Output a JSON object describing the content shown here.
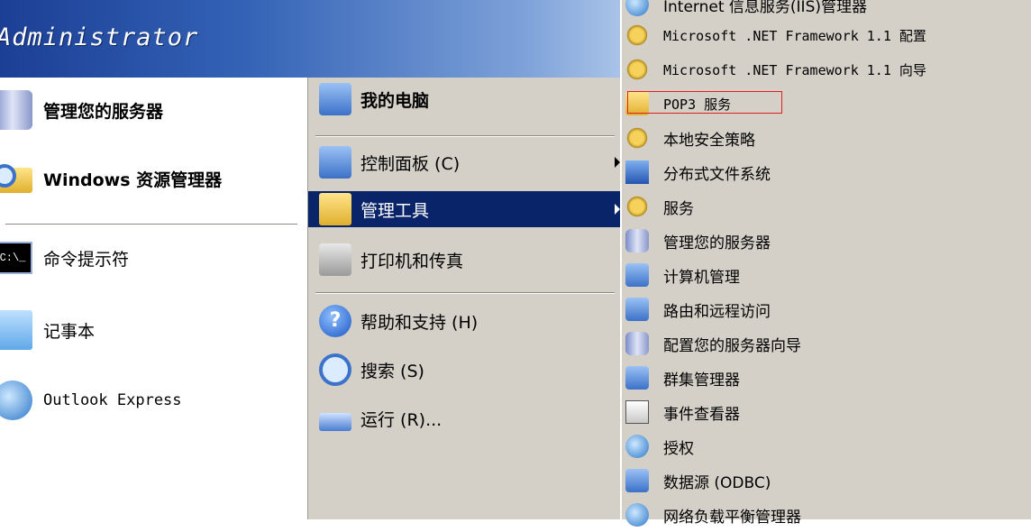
{
  "start_menu": {
    "user_name": "Administrator",
    "left_items": [
      {
        "label": "管理您的服务器",
        "icon": "server-manage-icon"
      },
      {
        "label": "Windows 资源管理器",
        "icon": "explorer-icon"
      },
      {
        "label": "命令提示符",
        "icon": "command-prompt-icon",
        "icon_text": "C:\\_"
      },
      {
        "label": "记事本",
        "icon": "notepad-icon"
      },
      {
        "label": "Outlook Express",
        "icon": "outlook-express-icon"
      }
    ],
    "right_items": [
      {
        "label": "我的电脑",
        "icon": "my-computer-icon"
      },
      {
        "label": "控制面板 (C)",
        "icon": "control-panel-icon"
      },
      {
        "label": "管理工具",
        "icon": "admin-tools-icon"
      },
      {
        "label": "打印机和传真",
        "icon": "printer-fax-icon"
      },
      {
        "label": "帮助和支持 (H)",
        "icon": "help-icon",
        "icon_text": "?"
      },
      {
        "label": "搜索 (S)",
        "icon": "search-icon"
      },
      {
        "label": "运行 (R)...",
        "icon": "run-icon"
      }
    ]
  },
  "submenu": {
    "items": [
      {
        "label": "Internet 信息服务(IIS)管理器",
        "icon": "iis-icon"
      },
      {
        "label": "Microsoft .NET Framework 1.1 配置",
        "icon": "dotnet-config-icon"
      },
      {
        "label": "Microsoft .NET Framework 1.1 向导",
        "icon": "dotnet-wizard-icon"
      },
      {
        "label": "POP3 服务",
        "icon": "pop3-icon"
      },
      {
        "label": "本地安全策略",
        "icon": "security-policy-icon"
      },
      {
        "label": "分布式文件系统",
        "icon": "dfs-icon"
      },
      {
        "label": "服务",
        "icon": "services-icon"
      },
      {
        "label": "管理您的服务器",
        "icon": "server-manage-icon"
      },
      {
        "label": "计算机管理",
        "icon": "computer-management-icon"
      },
      {
        "label": "路由和远程访问",
        "icon": "routing-icon"
      },
      {
        "label": "配置您的服务器向导",
        "icon": "configure-server-icon"
      },
      {
        "label": "群集管理器",
        "icon": "cluster-icon"
      },
      {
        "label": "事件查看器",
        "icon": "event-viewer-icon"
      },
      {
        "label": "授权",
        "icon": "licensing-icon"
      },
      {
        "label": "数据源 (ODBC)",
        "icon": "odbc-icon"
      },
      {
        "label": "网络负载平衡管理器",
        "icon": "nlb-icon"
      }
    ]
  },
  "colors": {
    "header_start": "#1b3f95",
    "header_end": "#a9c3e8",
    "selection": "#0a246a",
    "menu_bg": "#d4d0c8",
    "highlight_box": "#e02020"
  }
}
